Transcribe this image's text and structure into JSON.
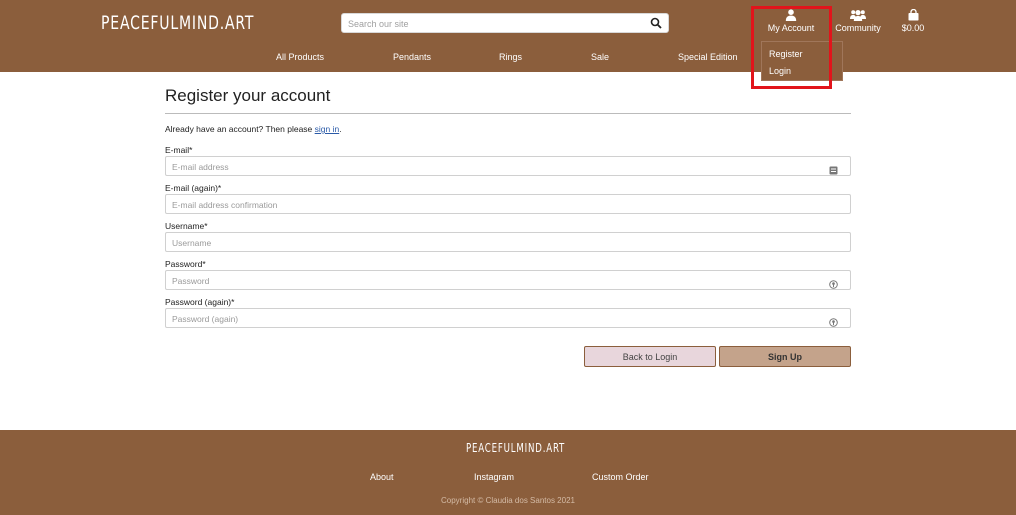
{
  "header": {
    "logo": "PEACEFULMIND.ART",
    "search": {
      "placeholder": "Search our site"
    },
    "account_label": "My Account",
    "community_label": "Community",
    "bag_total": "$0.00",
    "nav": [
      "All Products",
      "Pendants",
      "Rings",
      "Sale",
      "Special Edition"
    ],
    "dropdown": [
      "Register",
      "Login"
    ],
    "highlight_color": "#e2141b"
  },
  "form": {
    "title": "Register your account",
    "already_text": "Already have an account? Then please",
    "sign_in_link": "sign in",
    "already_end": ".",
    "fields": [
      {
        "label": "E-mail*",
        "placeholder": "E-mail address"
      },
      {
        "label": "E-mail (again)*",
        "placeholder": "E-mail address confirmation"
      },
      {
        "label": "Username*",
        "placeholder": "Username"
      },
      {
        "label": "Password*",
        "placeholder": "Password"
      },
      {
        "label": "Password (again)*",
        "placeholder": "Password (again)"
      }
    ],
    "back_button": "Back to Login",
    "signup_button": "Sign Up"
  },
  "footer": {
    "logo": "PEACEFULMIND.ART",
    "links": [
      "About",
      "Instagram",
      "Custom Order"
    ],
    "copyright": "Copyright © Claudia dos Santos 2021"
  },
  "colors": {
    "brand": "#8b5e3c",
    "back_button": "#e8d6dc",
    "signup_button": "#c4a38b"
  }
}
